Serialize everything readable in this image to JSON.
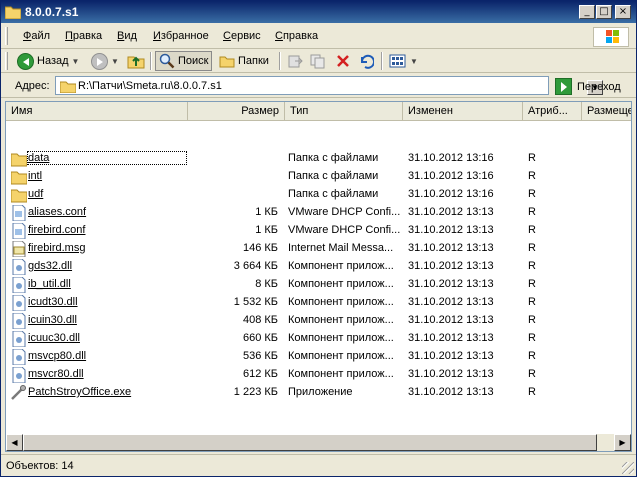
{
  "window": {
    "title": "8.0.0.7.s1"
  },
  "menu": [
    {
      "label": "Файл",
      "u": "Ф",
      "rest": "айл"
    },
    {
      "label": "Правка",
      "u": "П",
      "rest": "равка"
    },
    {
      "label": "Вид",
      "u": "В",
      "rest": "ид"
    },
    {
      "label": "Избранное",
      "u": "И",
      "rest": "збранное"
    },
    {
      "label": "Сервис",
      "u": "С",
      "rest": "ервис"
    },
    {
      "label": "Справка",
      "u": "С",
      "rest": "правка"
    }
  ],
  "toolbar": {
    "back_label": "Назад",
    "search_label": "Поиск",
    "folders_label": "Папки"
  },
  "address": {
    "label": "Адрес:",
    "value": "R:\\Патчи\\Smeta.ru\\8.0.0.7.s1",
    "go_label": "Переход"
  },
  "columns": [
    "Имя",
    "Размер",
    "Тип",
    "Изменен",
    "Атриб...",
    "Размеще..."
  ],
  "files": [
    {
      "name": "data",
      "size": "",
      "type": "Папка с файлами",
      "date": "31.10.2012 13:16",
      "attr": "R",
      "icon": "folder-icon"
    },
    {
      "name": "intl",
      "size": "",
      "type": "Папка с файлами",
      "date": "31.10.2012 13:16",
      "attr": "R",
      "icon": "folder-icon"
    },
    {
      "name": "udf",
      "size": "",
      "type": "Папка с файлами",
      "date": "31.10.2012 13:16",
      "attr": "R",
      "icon": "folder-icon"
    },
    {
      "name": "aliases.conf",
      "size": "1 КБ",
      "type": "VMware DHCP Confi...",
      "date": "31.10.2012 13:13",
      "attr": "R",
      "icon": "conf-file-icon"
    },
    {
      "name": "firebird.conf",
      "size": "1 КБ",
      "type": "VMware DHCP Confi...",
      "date": "31.10.2012 13:13",
      "attr": "R",
      "icon": "conf-file-icon"
    },
    {
      "name": "firebird.msg",
      "size": "146 КБ",
      "type": "Internet Mail Messa...",
      "date": "31.10.2012 13:13",
      "attr": "R",
      "icon": "mail-file-icon"
    },
    {
      "name": "gds32.dll",
      "size": "3 664 КБ",
      "type": "Компонент прилож...",
      "date": "31.10.2012 13:13",
      "attr": "R",
      "icon": "dll-file-icon"
    },
    {
      "name": "ib_util.dll",
      "size": "8 КБ",
      "type": "Компонент прилож...",
      "date": "31.10.2012 13:13",
      "attr": "R",
      "icon": "dll-file-icon"
    },
    {
      "name": "icudt30.dll",
      "size": "1 532 КБ",
      "type": "Компонент прилож...",
      "date": "31.10.2012 13:13",
      "attr": "R",
      "icon": "dll-file-icon"
    },
    {
      "name": "icuin30.dll",
      "size": "408 КБ",
      "type": "Компонент прилож...",
      "date": "31.10.2012 13:13",
      "attr": "R",
      "icon": "dll-file-icon"
    },
    {
      "name": "icuuc30.dll",
      "size": "660 КБ",
      "type": "Компонент прилож...",
      "date": "31.10.2012 13:13",
      "attr": "R",
      "icon": "dll-file-icon"
    },
    {
      "name": "msvcp80.dll",
      "size": "536 КБ",
      "type": "Компонент прилож...",
      "date": "31.10.2012 13:13",
      "attr": "R",
      "icon": "dll-file-icon"
    },
    {
      "name": "msvcr80.dll",
      "size": "612 КБ",
      "type": "Компонент прилож...",
      "date": "31.10.2012 13:13",
      "attr": "R",
      "icon": "dll-file-icon"
    },
    {
      "name": "PatchStroyOffice.exe",
      "size": "1 223 КБ",
      "type": "Приложение",
      "date": "31.10.2012 13:13",
      "attr": "R",
      "icon": "exe-file-icon"
    }
  ],
  "status": {
    "text": "Объектов: 14"
  }
}
